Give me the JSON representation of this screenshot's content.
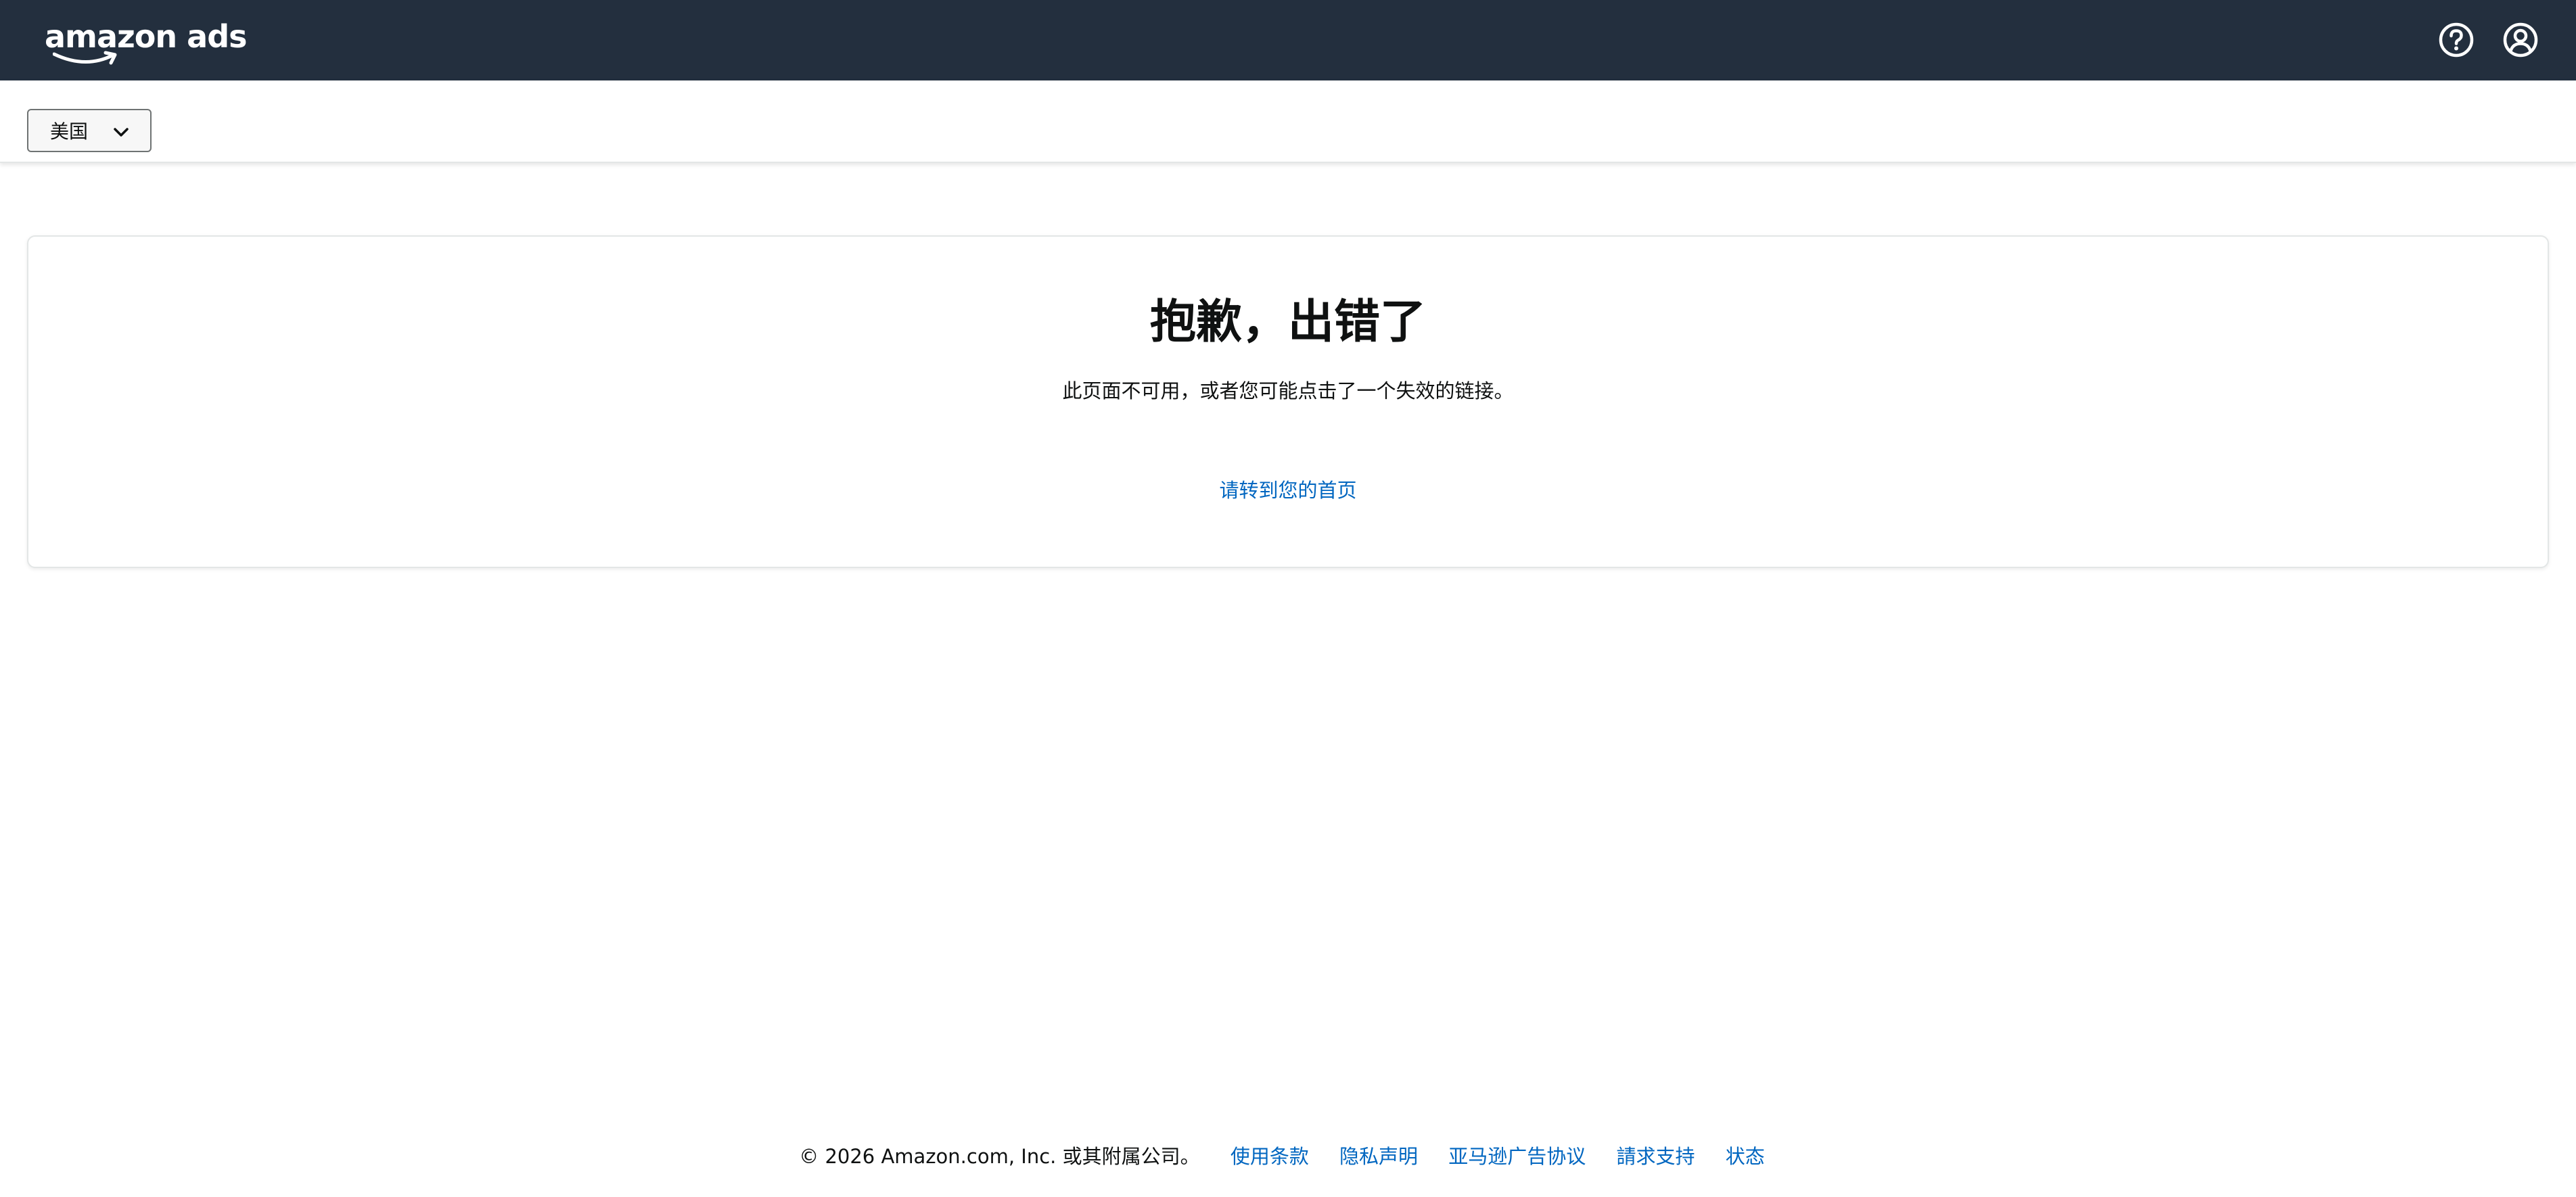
{
  "brand": {
    "logo_text": "amazon ads",
    "logo_icon": "amazon-smile-arrow"
  },
  "header": {
    "help_icon": "question-circle-icon",
    "account_icon": "user-circle-icon",
    "background_color": "#232f3e"
  },
  "locale": {
    "selected": "美国",
    "icon": "chevron-down-icon"
  },
  "error": {
    "title": "抱歉，出错了",
    "description": "此页面不可用，或者您可能点击了一个失效的链接。",
    "home_link": "请转到您的首页"
  },
  "footer": {
    "copyright": "© 2026 Amazon.com, Inc. 或其附属公司。",
    "links": [
      {
        "label": "使用条款"
      },
      {
        "label": "隐私声明"
      },
      {
        "label": "亚马逊广告协议"
      },
      {
        "label": "請求支持"
      },
      {
        "label": "状态"
      }
    ]
  },
  "colors": {
    "link": "#0066c0",
    "text": "#0f1111",
    "nav": "#232f3e"
  }
}
